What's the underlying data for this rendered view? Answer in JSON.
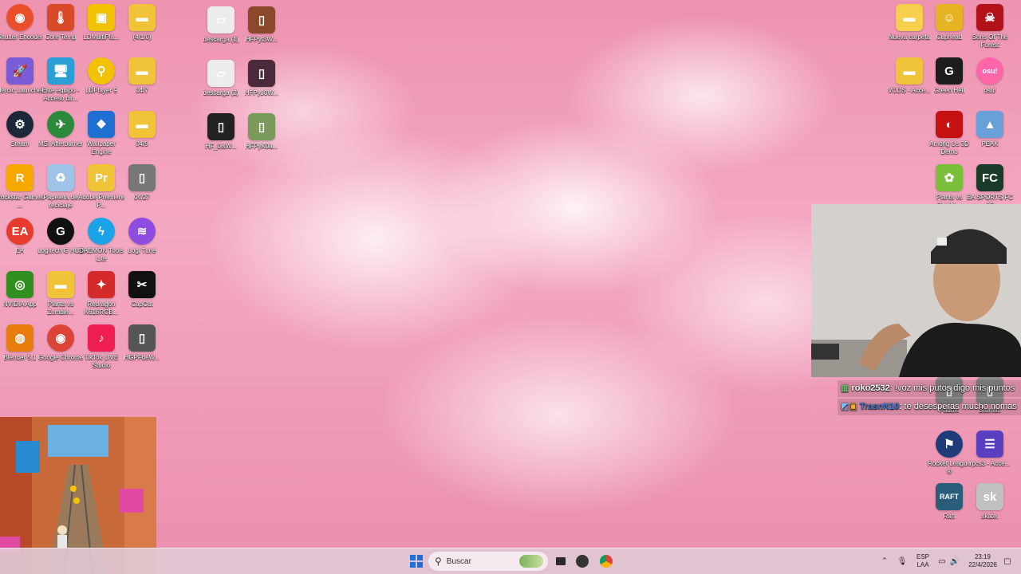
{
  "desktop_left": [
    {
      "label": "Shutter Encoder",
      "color": "#e94f2b",
      "glyph": "◉",
      "icon": "shutter-encoder-icon",
      "round": true
    },
    {
      "label": "Core Temp",
      "color": "#d94a2a",
      "glyph": "🌡",
      "icon": "thermometer-icon"
    },
    {
      "label": "LDMultiPla...",
      "color": "#f2c100",
      "glyph": "▣",
      "icon": "ldmultiplayer-icon"
    },
    {
      "label": "(4/1/0)",
      "color": "#f1c338",
      "glyph": "▬",
      "icon": "folder-icon"
    },
    {
      "label": "Heroic Launcher",
      "color": "#7a5bd6",
      "glyph": "🚀",
      "icon": "heroic-launcher-icon"
    },
    {
      "label": "Este equipo - Acceso dir...",
      "color": "#2a9fd6",
      "glyph": "🖥",
      "icon": "this-pc-icon"
    },
    {
      "label": "LDPlayer 9",
      "color": "#f2c100",
      "glyph": "⚲",
      "icon": "ldplayer-icon",
      "round": true
    },
    {
      "label": "04/7",
      "color": "#f1c338",
      "glyph": "▬",
      "icon": "folder-icon"
    },
    {
      "label": "Steam",
      "color": "#1b2838",
      "glyph": "⚙",
      "icon": "steam-icon",
      "round": true
    },
    {
      "label": "MSI Afterburner",
      "color": "#2a8a3a",
      "glyph": "✈",
      "icon": "msi-afterburner-icon",
      "round": true
    },
    {
      "label": "Wallpaper Engine",
      "color": "#1e6fd1",
      "glyph": "❖",
      "icon": "wallpaper-engine-icon"
    },
    {
      "label": "04/9",
      "color": "#f1c338",
      "glyph": "▬",
      "icon": "folder-icon"
    },
    {
      "label": "Rockstar Games ...",
      "color": "#f6a800",
      "glyph": "R",
      "icon": "rockstar-games-icon"
    },
    {
      "label": "Papelera de reciclaje",
      "color": "#9ec3e6",
      "glyph": "♻",
      "icon": "recycle-bin-icon"
    },
    {
      "label": "Adobe Premiere P...",
      "color": "#f1c338",
      "glyph": "Pr",
      "icon": "premiere-folder-icon"
    },
    {
      "label": "04/27",
      "color": "#777777",
      "glyph": "▯",
      "icon": "image-icon"
    },
    {
      "label": "EA",
      "color": "#e63b2e",
      "glyph": "EA",
      "icon": "ea-icon",
      "round": true
    },
    {
      "label": "Logitech G HUB",
      "color": "#111111",
      "glyph": "G",
      "icon": "logitech-ghub-icon",
      "round": true
    },
    {
      "label": "DAEMON Tools Lite",
      "color": "#1aa3e8",
      "glyph": "ϟ",
      "icon": "daemon-tools-icon",
      "round": true
    },
    {
      "label": "Logi Tune",
      "color": "#8e4ce0",
      "glyph": "≋",
      "icon": "logi-tune-icon",
      "round": true
    },
    {
      "label": "NVIDIA App",
      "color": "#2f8f1f",
      "glyph": "◎",
      "icon": "nvidia-app-icon"
    },
    {
      "label": "Plants vs Zombie...",
      "color": "#f1c338",
      "glyph": "▬",
      "icon": "folder-icon"
    },
    {
      "label": "Redragon K616RGB...",
      "color": "#d42a2a",
      "glyph": "✦",
      "icon": "redragon-icon"
    },
    {
      "label": "CapCut",
      "color": "#111111",
      "glyph": "✂",
      "icon": "capcut-icon"
    },
    {
      "label": "Blender 5.1",
      "color": "#e87d0d",
      "glyph": "◍",
      "icon": "blender-icon"
    },
    {
      "label": "Google Chrome",
      "color": "#db4437",
      "glyph": "◉",
      "icon": "google-chrome-icon",
      "round": true
    },
    {
      "label": "TikTok LIVE Studio",
      "color": "#ee1d52",
      "glyph": "♪",
      "icon": "tiktok-live-icon"
    },
    {
      "label": "HGPFdeW...",
      "color": "#555555",
      "glyph": "▯",
      "icon": "image-icon"
    }
  ],
  "desktop_mid": [
    {
      "label": "descarga (1)",
      "color": "#ececec",
      "glyph": "▱",
      "icon": "image-icon"
    },
    {
      "label": "HFPyt3W...",
      "color": "#8a4a2a",
      "glyph": "▯",
      "icon": "image-icon"
    },
    {
      "label": "descarga (2)",
      "color": "#ececec",
      "glyph": "▱",
      "icon": "image-icon"
    },
    {
      "label": "HFPyJ0W...",
      "color": "#4a2a3a",
      "glyph": "▯",
      "icon": "image-icon"
    },
    {
      "label": "HF_0lsW...",
      "color": "#222222",
      "glyph": "▯",
      "icon": "image-icon"
    },
    {
      "label": "HFPyK0a...",
      "color": "#7a9a5a",
      "glyph": "▯",
      "icon": "image-icon"
    }
  ],
  "desktop_right": [
    {
      "label": "Nueva carpeta",
      "color": "#f6d04d",
      "glyph": "▬",
      "icon": "folder-icon"
    },
    {
      "label": "Cuphead",
      "color": "#e6b422",
      "glyph": "☺",
      "icon": "cuphead-icon"
    },
    {
      "label": "Sons Of The Forest",
      "color": "#b3121b",
      "glyph": "☠",
      "icon": "sons-of-the-forest-icon"
    },
    {
      "label": "VODS - Acce...",
      "color": "#f1c338",
      "glyph": "▬",
      "icon": "folder-icon"
    },
    {
      "label": "Green Hell",
      "color": "#1d1d1d",
      "glyph": "G",
      "icon": "green-hell-icon"
    },
    {
      "label": "osu!",
      "color": "#ff66aa",
      "glyph": "osu!",
      "icon": "osu-icon",
      "round": true
    },
    {
      "label": "Among Us 3D Demo",
      "color": "#c51111",
      "glyph": "◐",
      "icon": "among-us-icon"
    },
    {
      "label": "PEAK",
      "color": "#6aa0d8",
      "glyph": "▲",
      "icon": "peak-icon"
    },
    {
      "label": "Plants vs Zombi...",
      "color": "#7cbf3a",
      "glyph": "✿",
      "icon": "pvz-icon"
    },
    {
      "label": "EA SPORTS FC 25",
      "color": "#1a3a2a",
      "glyph": "FC",
      "icon": "ea-sports-fc-icon"
    },
    {
      "label": "Paddle",
      "color": "#888888",
      "glyph": "▯",
      "icon": "paddle-icon"
    },
    {
      "label": "Batman",
      "color": "#888888",
      "glyph": "▯",
      "icon": "batman-icon"
    },
    {
      "label": "Rocket League ®",
      "color": "#1e3c78",
      "glyph": "⚑",
      "icon": "rocket-league-icon",
      "round": true
    },
    {
      "label": "rpcs3 - Acce...",
      "color": "#5a3fc0",
      "glyph": "☰",
      "icon": "rpcs3-icon"
    },
    {
      "label": "Raft",
      "color": "#2a5d7a",
      "glyph": "RAFT",
      "icon": "raft-icon"
    },
    {
      "label": "skate.",
      "color": "#c0c0c0",
      "glyph": "sk",
      "icon": "skate-icon"
    }
  ],
  "chat": [
    {
      "user": "roko2532",
      "user_color": "#ffffff",
      "text": ": !voz mis putos digo mis puntos"
    },
    {
      "user": "TrasnN10",
      "user_color": "#3a7bd5",
      "text": ": te desesperas mucho nomas"
    }
  ],
  "taskbar": {
    "search_placeholder": "Buscar",
    "lang_top": "ESP",
    "lang_bottom": "LAA",
    "time": "23:19",
    "date": "22/4/2026"
  }
}
